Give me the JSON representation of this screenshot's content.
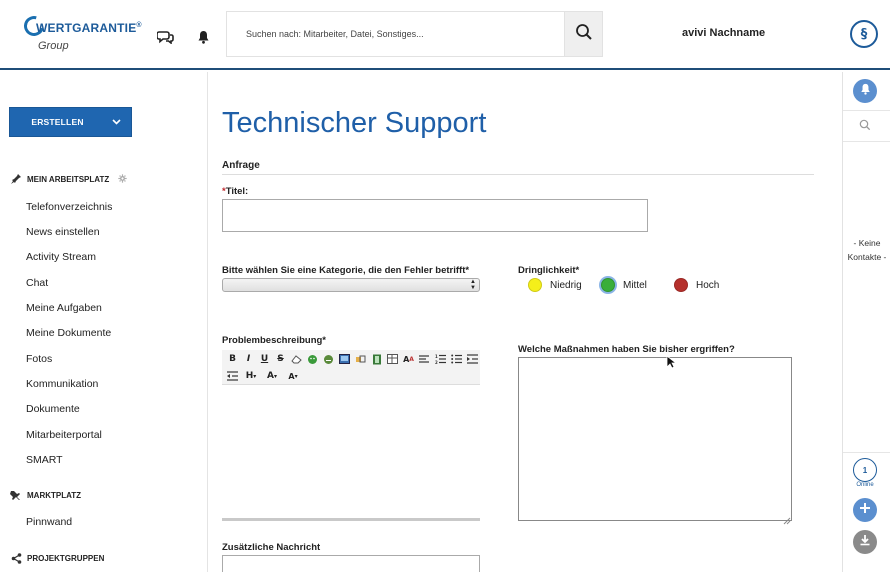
{
  "header": {
    "logo_main": "WERTGARANTIE",
    "logo_reg": "®",
    "logo_sub": "Group",
    "chat_icon": "chat-bubbles-icon",
    "bell_icon": "bell-icon",
    "search_placeholder": "Suchen nach: Mitarbeiter, Datei, Sonstiges...",
    "search_icon": "search-icon",
    "user_name": "avivi Nachname",
    "paragraph_symbol": "§"
  },
  "sidebar": {
    "create_label": "ERSTELLEN",
    "sections": [
      {
        "title": "MEIN ARBEITSPLATZ",
        "icon": "pin-icon"
      },
      {
        "title": "MARKTPLATZ",
        "icon": "pushpin-icon"
      },
      {
        "title": "PROJEKTGRUPPEN",
        "icon": "share-icon"
      }
    ],
    "items": [
      "Telefonverzeichnis",
      "News einstellen",
      "Activity Stream",
      "Chat",
      "Meine Aufgaben",
      "Meine Dokumente",
      "Fotos",
      "Kommunikation",
      "Dokumente",
      "Mitarbeiterportal",
      "SMART"
    ],
    "marketplace_items": [
      "Pinnwand"
    ]
  },
  "main": {
    "title": "Technischer Support",
    "section": "Anfrage",
    "title_field": {
      "required_mark": "*",
      "label": "Titel:",
      "value": ""
    },
    "category": {
      "label": "Bitte wählen Sie eine Kategorie, die den Fehler betrifft*",
      "value": ""
    },
    "urgency": {
      "label": "Dringlichkeit*",
      "options": [
        {
          "label": "Niedrig",
          "color": "#f5ef1a"
        },
        {
          "label": "Mittel",
          "color": "#3aae3a",
          "selected": true
        },
        {
          "label": "Hoch",
          "color": "#b5302c"
        }
      ]
    },
    "problem": {
      "label": "Problembeschreibung*"
    },
    "measures": {
      "label": "Welche Maßnahmen haben Sie bisher ergriffen?"
    },
    "extra": {
      "label": "Zusätzliche Nachricht"
    },
    "toolbar_row1": [
      "B",
      "I",
      "U",
      "S",
      "eraser",
      "smiley-1",
      "smiley-2",
      "image",
      "link",
      "film",
      "table",
      "font",
      "align",
      "ol",
      "ul",
      "indent"
    ],
    "toolbar_row2": [
      "outdent",
      "H",
      "A",
      "A"
    ]
  },
  "rail": {
    "contacts_text": "- Keine Kontakte -",
    "online_count": "1",
    "online_label": "Online"
  },
  "colors": {
    "brand": "#1f5fa8",
    "button": "#1f66b0",
    "rail_blue": "#5b8fcf"
  }
}
